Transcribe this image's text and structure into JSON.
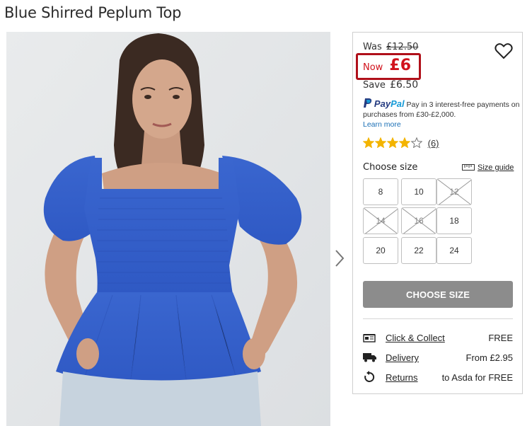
{
  "product": {
    "title": "Blue Shirred Peplum Top"
  },
  "pricing": {
    "was_label": "Was",
    "was_price": "£12.50",
    "now_label": "Now",
    "now_price": "£6",
    "save_label": "Save",
    "save_amount": "£6.50",
    "highlight_color": "#b0101a",
    "price_color": "#d1121c"
  },
  "paypal": {
    "brand_a": "Pay",
    "brand_b": "Pal",
    "text": "Pay in 3 interest-free payments on purchases from £30-£2,000.",
    "link": "Learn more"
  },
  "rating": {
    "stars": 4,
    "max_stars": 5,
    "count": "(6)",
    "star_color": "#f3b400"
  },
  "sizes": {
    "heading": "Choose size",
    "guide_label": "Size guide",
    "options": [
      {
        "label": "8",
        "available": true
      },
      {
        "label": "10",
        "available": true
      },
      {
        "label": "12",
        "available": false
      },
      {
        "label": "14",
        "available": false
      },
      {
        "label": "16",
        "available": false
      },
      {
        "label": "18",
        "available": true
      },
      {
        "label": "20",
        "available": true
      },
      {
        "label": "22",
        "available": true
      },
      {
        "label": "24",
        "available": true
      }
    ]
  },
  "cta": {
    "label": "CHOOSE SIZE",
    "color": "#8c8c8c"
  },
  "delivery": [
    {
      "icon": "store-icon",
      "label": "Click & Collect",
      "value": "FREE"
    },
    {
      "icon": "truck-icon",
      "label": "Delivery",
      "value": "From £2.95"
    },
    {
      "icon": "returns-icon",
      "label": "Returns",
      "value": "to Asda for FREE"
    }
  ]
}
